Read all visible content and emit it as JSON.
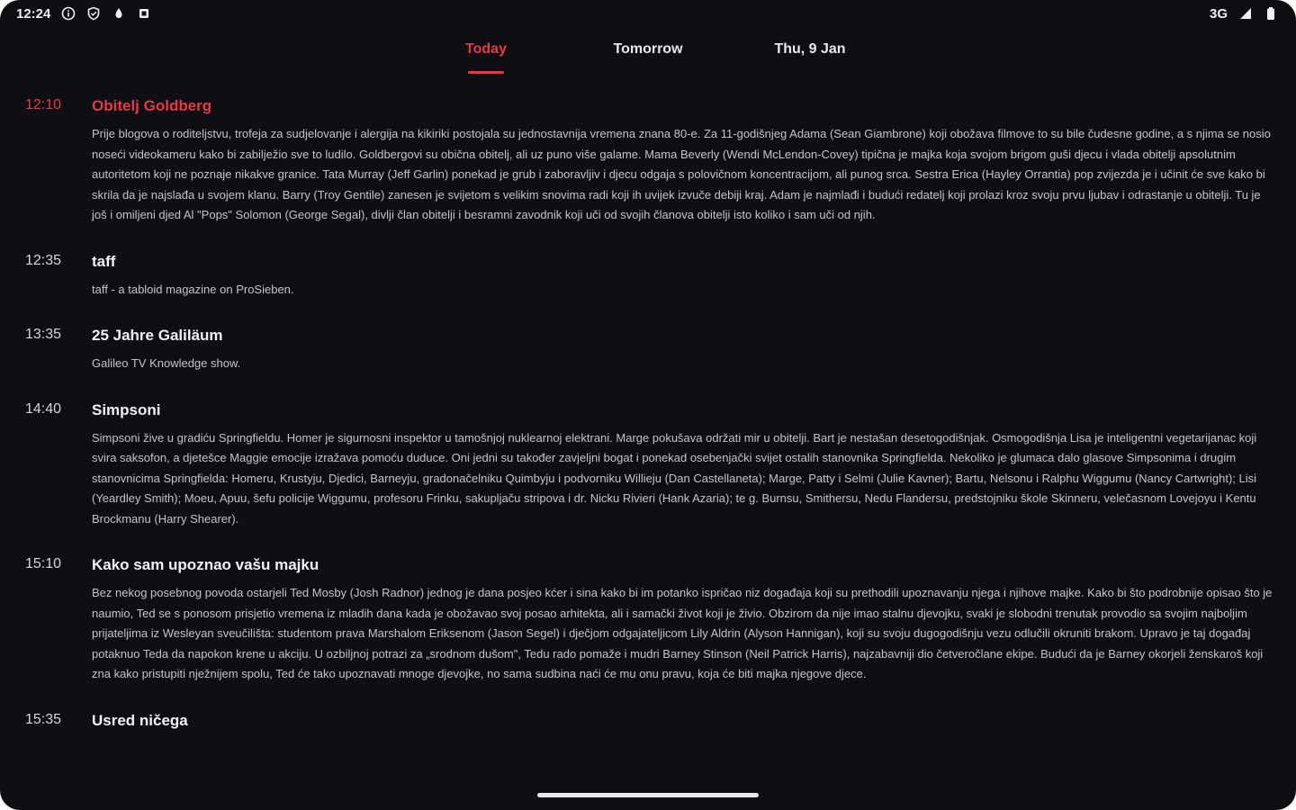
{
  "status_bar": {
    "time": "12:24",
    "network": "3G",
    "left_icons": [
      "info-circle-icon",
      "shield-icon",
      "drop-icon",
      "square-icon"
    ],
    "right_icons": [
      "signal-icon",
      "battery-icon"
    ]
  },
  "tabs": [
    {
      "label": "Today",
      "active": true
    },
    {
      "label": "Tomorrow",
      "active": false
    },
    {
      "label": "Thu, 9 Jan",
      "active": false
    }
  ],
  "accent_color": "#e53945",
  "programs": [
    {
      "time": "12:10",
      "title": "Obitelj Goldberg",
      "current": true,
      "description": "Prije blogova o roditeljstvu, trofeja za sudjelovanje i alergija na kikiriki postojala su jednostavnija vremena znana 80-e. Za 11-godišnjeg Adama (Sean Giambrone) koji obožava filmove to su bile čudesne godine, a s njima se nosio noseći videokameru kako bi zabilježio sve to ludilo. Goldbergovi su obična obitelj, ali uz puno više galame. Mama Beverly (Wendi McLendon-Covey) tipična je majka koja svojom brigom guši djecu i vlada obitelji apsolutnim autoritetom koji ne poznaje nikakve granice. Tata Murray (Jeff Garlin) ponekad je grub i zaboravljiv i djecu odgaja s polovičnom koncentracijom, ali punog srca. Sestra Erica (Hayley Orrantia) pop zvijezda je i učinit će sve kako bi skrila da je najslađa u svojem klanu. Barry (Troy Gentile) zanesen je svijetom s velikim snovima radi koji ih uvijek izvuče debiji kraj. Adam je najmlađi i budući redatelj koji prolazi kroz svoju prvu ljubav i odrastanje u obitelji. Tu je još i omiljeni djed Al \"Pops\" Solomon (George Segal), divlji član obitelji i besramni zavodnik koji uči od svojih članova obitelji isto koliko i sam uči od njih."
    },
    {
      "time": "12:35",
      "title": "taff",
      "current": false,
      "description": "taff - a tabloid magazine on ProSieben."
    },
    {
      "time": "13:35",
      "title": "25 Jahre Galiläum",
      "current": false,
      "description": "Galileo TV Knowledge show."
    },
    {
      "time": "14:40",
      "title": "Simpsoni",
      "current": false,
      "description": "Simpsoni žive u gradiću Springfieldu. Homer je sigurnosni inspektor u tamošnjoj nuklearnoj elektrani. Marge pokušava održati mir u obitelji. Bart je nestašan desetogodišnjak. Osmogodišnja Lisa je inteligentni vegetarijanac koji svira saksofon, a djetešce Maggie emocije izražava pomoću duduce. Oni jedni su također zavjeljni bogat i ponekad osebenjački svijet ostalih stanovnika Springfielda. Nekoliko je glumaca dalo glasove Simpsonima i drugim stanovnicima Springfielda: Homeru, Krustyju, Djedici, Barneyju, gradonačelniku Quimbyju i podvorniku Willieju (Dan Castellaneta); Marge, Patty i Selmi (Julie Kavner); Bartu, Nelsonu i Ralphu Wiggumu (Nancy Cartwright); Lisi (Yeardley Smith); Moeu, Apuu, šefu policije Wiggumu, profesoru Frinku, sakupljaču stripova i dr. Nicku Rivieri (Hank Azaria); te g. Burnsu, Smithersu, Nedu Flandersu, predstojniku škole Skinneru, velečasnom Lovejoyu i Kentu Brockmanu (Harry Shearer)."
    },
    {
      "time": "15:10",
      "title": "Kako sam upoznao vašu majku",
      "current": false,
      "description": "Bez nekog posebnog povoda ostarjeli Ted Mosby (Josh Radnor) jednog je dana posjeo kćer i sina kako bi im potanko ispričao niz događaja koji su prethodili upoznavanju njega i njihove majke. Kako bi što podrobnije opisao što je naumio, Ted se s ponosom prisjetio vremena iz mladih dana kada je obožavao svoj posao arhitekta, ali i samački život koji je živio. Obzirom da nije imao stalnu djevojku, svaki je slobodni trenutak provodio sa svojim najboljim prijateljima iz Wesleyan sveučilišta: studentom prava Marshalom Eriksenom (Jason Segel) i dječjom odgajateljicom Lily Aldrin (Alyson Hannigan), koji su svoju dugogodišnju vezu odlučili okruniti brakom. Upravo je taj događaj potaknuo Teda da napokon krene u akciju. U ozbiljnoj potrazi za „srodnom dušom\", Tedu rado pomaže i mudri Barney Stinson (Neil Patrick Harris), najzabavniji dio četveročlane ekipe. Budući da je Barney okorjeli ženskaroš koji zna kako pristupiti nježnijem spolu, Ted će tako upoznavati mnoge djevojke, no sama sudbina naći će mu onu pravu, koja će biti majka njegove djece."
    },
    {
      "time": "15:35",
      "title": "Usred ničega",
      "current": false,
      "description": ""
    }
  ]
}
